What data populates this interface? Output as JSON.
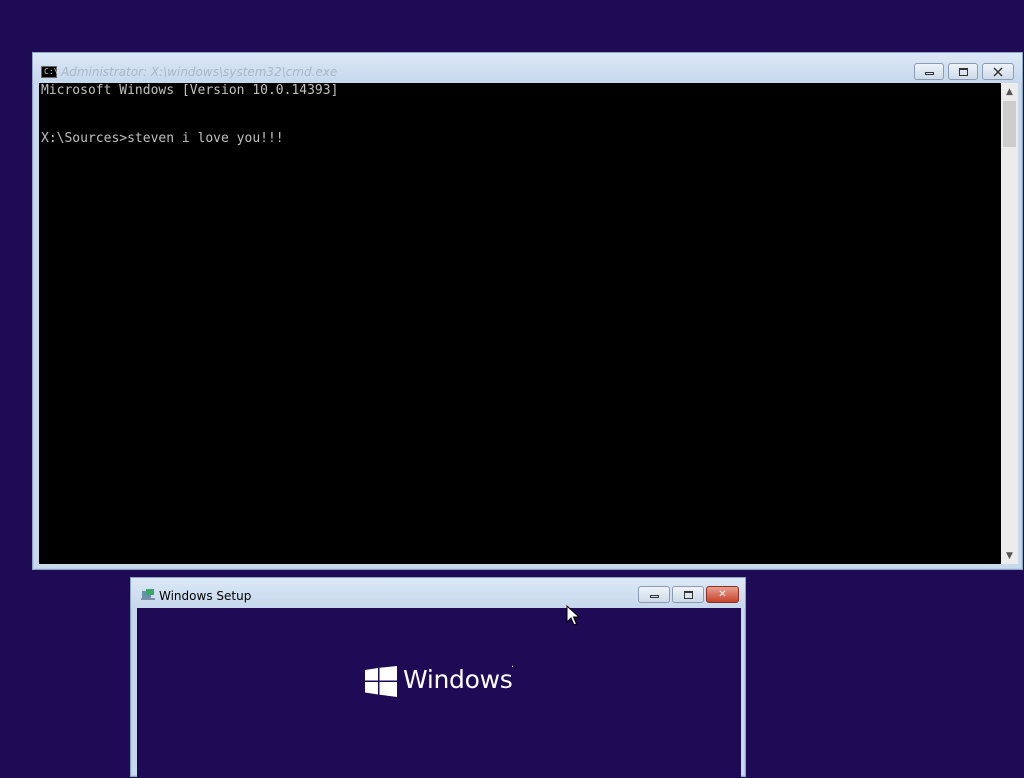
{
  "colors": {
    "desktop": "#1f0a55",
    "console_bg": "#000000",
    "console_text": "#c0c0c0",
    "close_button": "#c7422a"
  },
  "cmd_window": {
    "title": "Administrator: X:\\windows\\system32\\cmd.exe",
    "icon": "console-icon",
    "icon_label": "C:\\",
    "lines": [
      "Microsoft Windows [Version 10.0.14393]",
      "",
      "X:\\Sources>steven i love you!!!"
    ],
    "minimize_icon": "minimize-icon",
    "maximize_icon": "maximize-icon",
    "close_icon": "close-icon",
    "scroll_up": "▲",
    "scroll_down": "▼"
  },
  "setup_window": {
    "title": "Windows Setup",
    "icon": "setup-icon",
    "logo_text": "Windows",
    "logo_mark": "·",
    "close_symbol": "✕"
  },
  "cursor_icon": "mouse-pointer-icon"
}
